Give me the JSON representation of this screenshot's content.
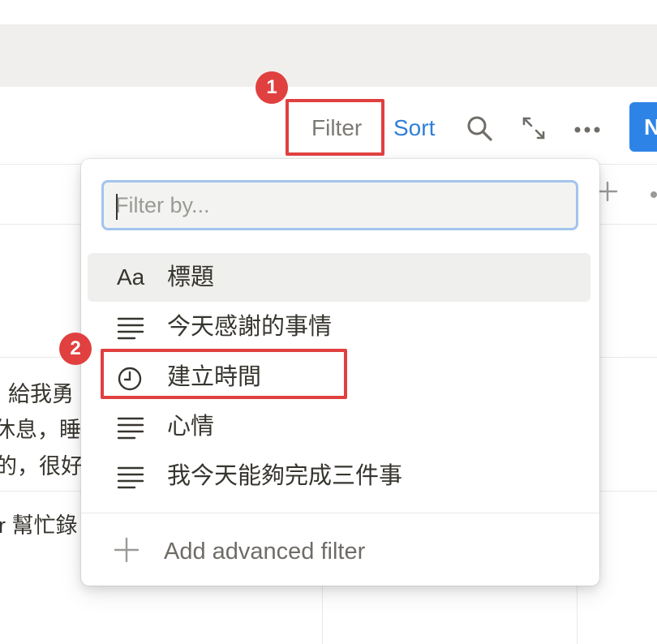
{
  "toolbar": {
    "filter_label": "Filter",
    "sort_label": "Sort",
    "new_label": "N",
    "icons": [
      "search-icon",
      "expand-icon",
      "more-icon"
    ]
  },
  "background_table": {
    "rows": [
      "給我勇",
      "休息，睡",
      "的，很好",
      "r 幫忙錄"
    ],
    "header_icons": [
      "plus-icon",
      "more-icon"
    ]
  },
  "annotations": {
    "badge_1": "1",
    "badge_2": "2",
    "highlight_color": "#e0403f"
  },
  "filter_dropdown": {
    "search_placeholder": "Filter by...",
    "search_value": "",
    "properties": [
      {
        "icon": "title-aa-icon",
        "icon_text": "Aa",
        "label": "標題"
      },
      {
        "icon": "text-lines-icon",
        "label": "今天感謝的事情"
      },
      {
        "icon": "clock-icon",
        "label": "建立時間"
      },
      {
        "icon": "text-lines-icon",
        "label": "心情"
      },
      {
        "icon": "text-lines-icon",
        "label": "我今天能夠完成三件事"
      }
    ],
    "advanced_label": "Add advanced filter"
  },
  "colors": {
    "accent_blue": "#2e84e6",
    "sort_blue": "#2f7fd8",
    "input_focus": "#a3c4ee",
    "annotation_red": "#e0403f"
  }
}
